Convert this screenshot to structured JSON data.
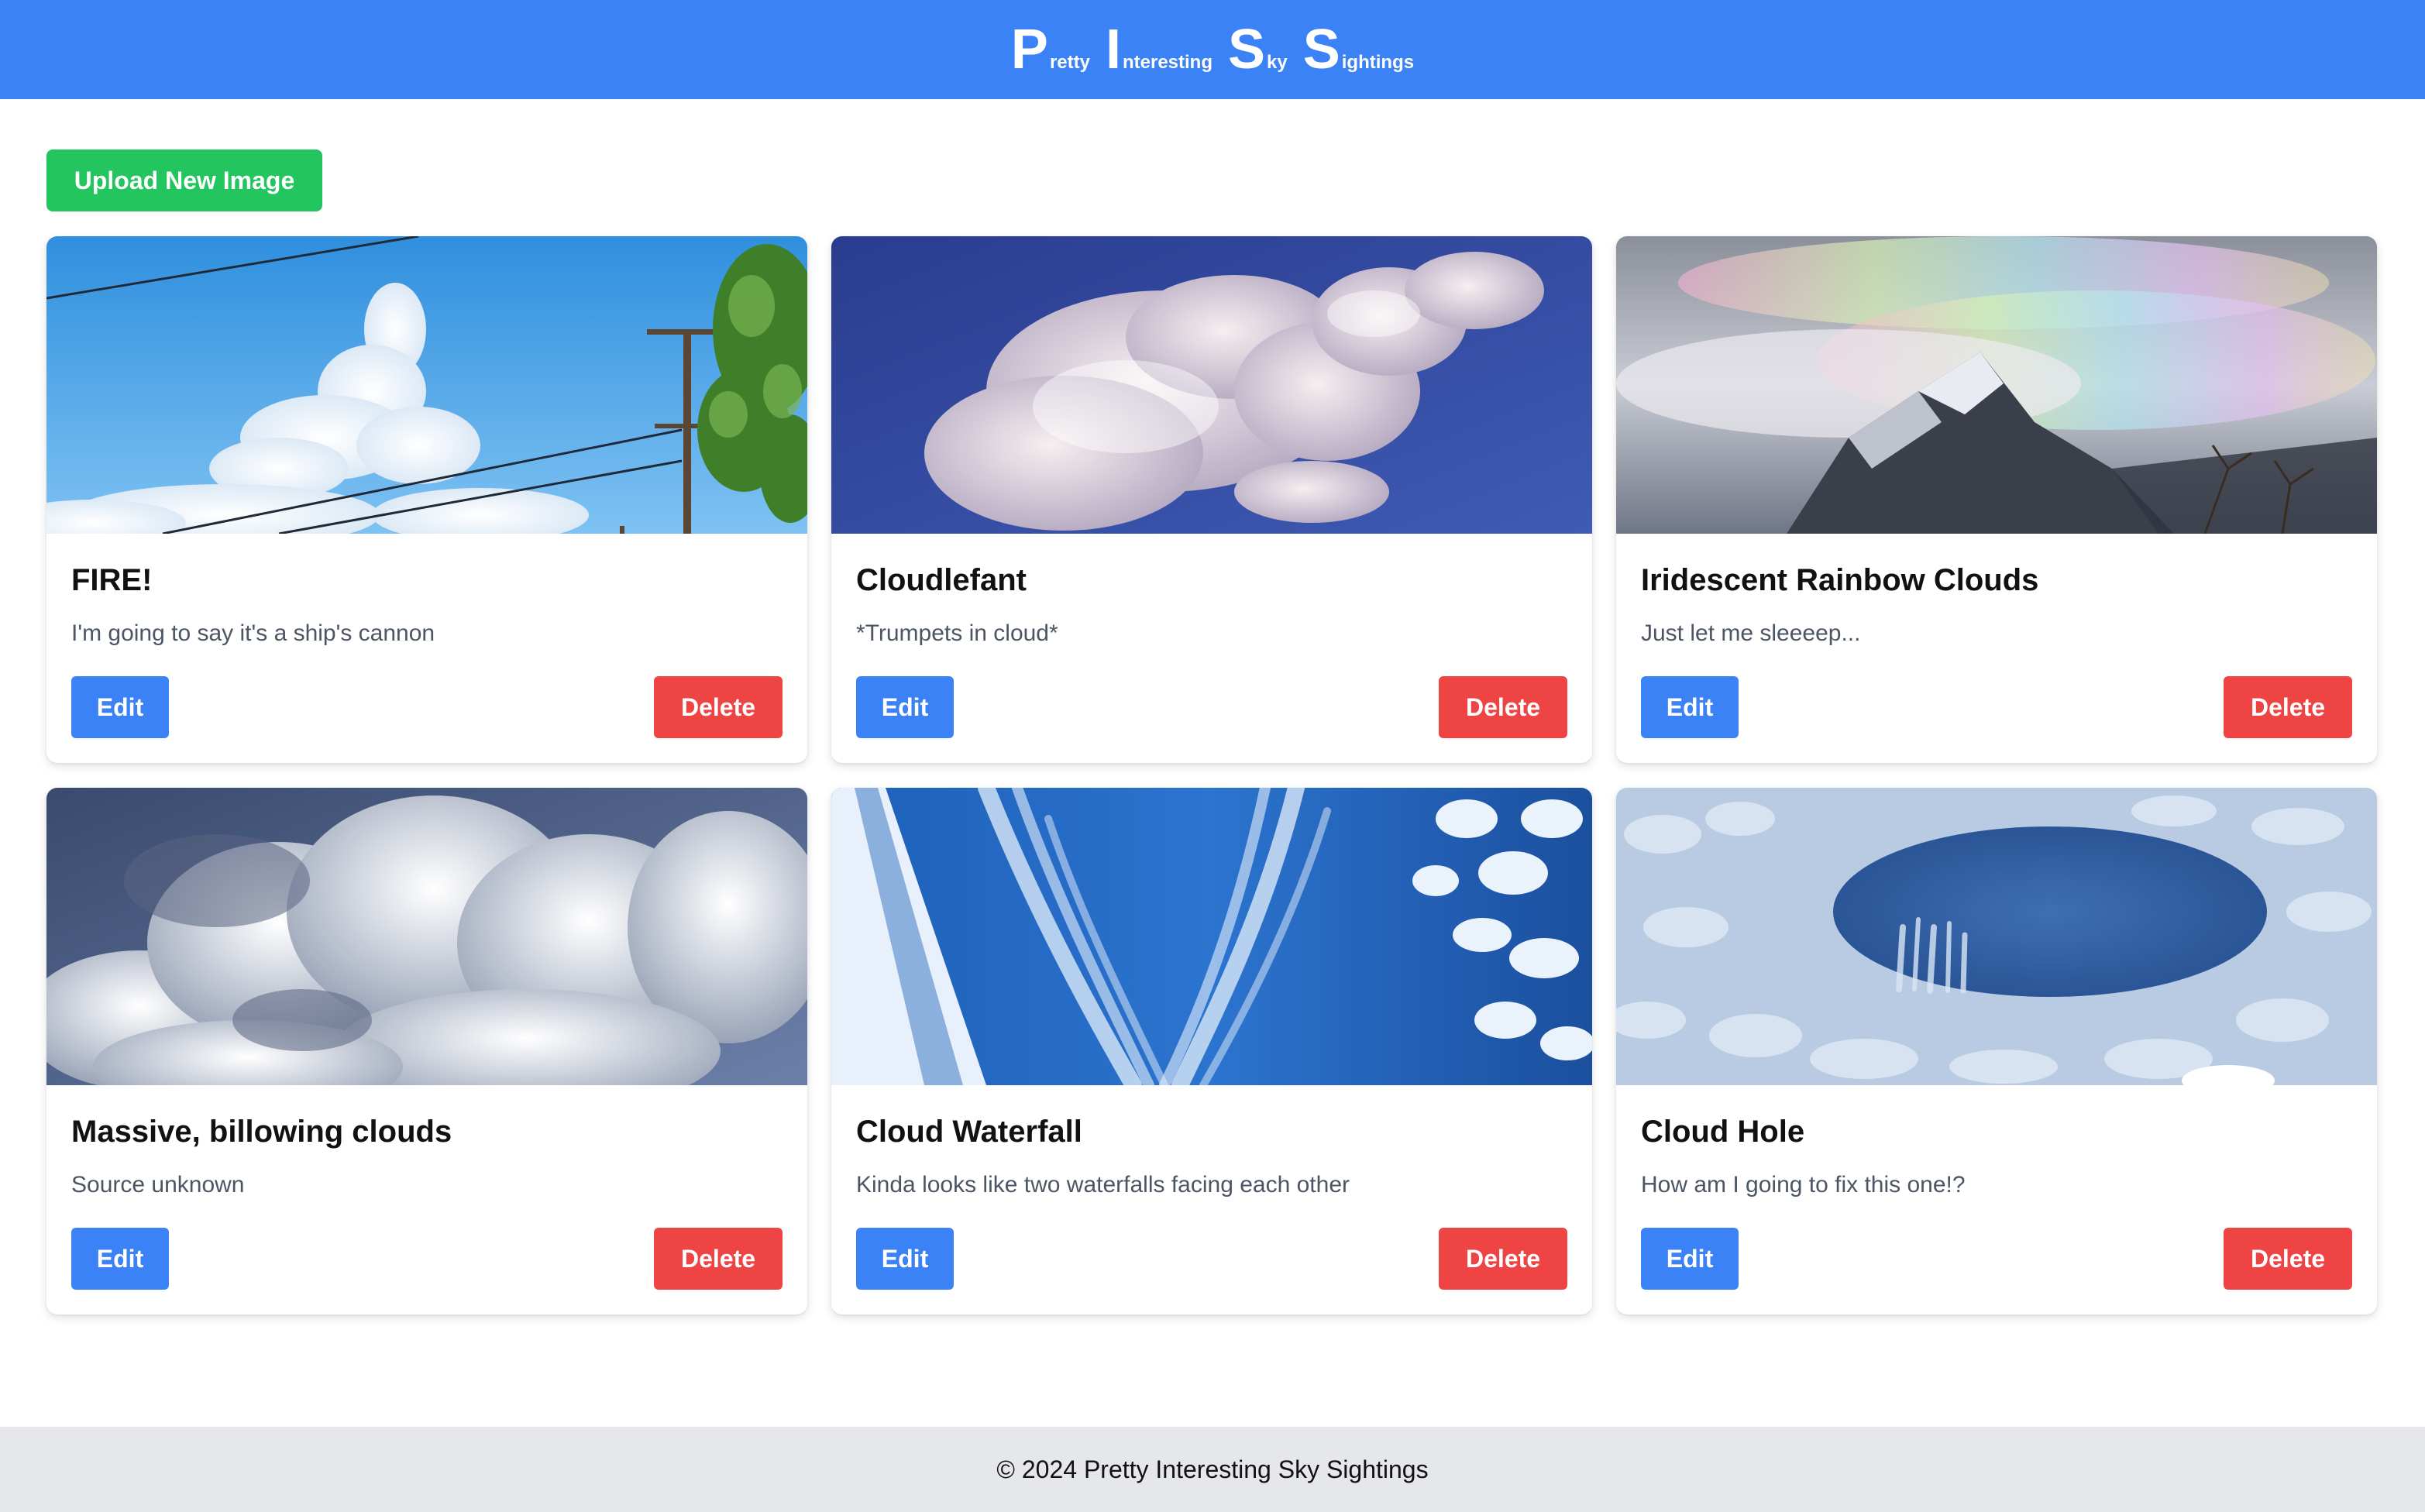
{
  "header": {
    "brand": [
      {
        "cap": "P",
        "rest": "retty"
      },
      {
        "cap": "I",
        "rest": "nteresting"
      },
      {
        "cap": "S",
        "rest": "ky"
      },
      {
        "cap": "S",
        "rest": "ightings"
      }
    ]
  },
  "toolbar": {
    "upload_label": "Upload New Image"
  },
  "cards": [
    {
      "title": "FIRE!",
      "description": "I'm going to say it's a ship's cannon",
      "edit_label": "Edit",
      "delete_label": "Delete"
    },
    {
      "title": "Cloudlefant",
      "description": "*Trumpets in cloud*",
      "edit_label": "Edit",
      "delete_label": "Delete"
    },
    {
      "title": "Iridescent Rainbow Clouds",
      "description": "Just let me sleeeep...",
      "edit_label": "Edit",
      "delete_label": "Delete"
    },
    {
      "title": "Massive, billowing clouds",
      "description": "Source unknown",
      "edit_label": "Edit",
      "delete_label": "Delete"
    },
    {
      "title": "Cloud Waterfall",
      "description": "Kinda looks like two waterfalls facing each other",
      "edit_label": "Edit",
      "delete_label": "Delete"
    },
    {
      "title": "Cloud Hole",
      "description": "How am I going to fix this one!?",
      "edit_label": "Edit",
      "delete_label": "Delete"
    }
  ],
  "footer": {
    "text": "© 2024 Pretty Interesting Sky Sightings"
  },
  "colors": {
    "header_bg": "#3b82f6",
    "upload_button": "#22c55e",
    "edit_button": "#3b82f6",
    "delete_button": "#ef4444",
    "footer_bg": "#e5e7eb"
  }
}
